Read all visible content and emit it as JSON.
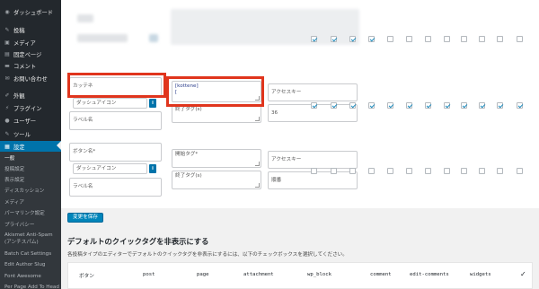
{
  "sidebar": {
    "items": [
      {
        "label": "ダッシュボード",
        "icon": "dashboard-icon",
        "glyph": "◉"
      },
      {
        "label": "投稿",
        "icon": "pushpin-icon",
        "glyph": "✎"
      },
      {
        "label": "メディア",
        "icon": "media-icon",
        "glyph": "▣"
      },
      {
        "label": "固定ページ",
        "icon": "page-icon",
        "glyph": "▤"
      },
      {
        "label": "コメント",
        "icon": "comment-icon",
        "glyph": "▬"
      },
      {
        "label": "お問い合わせ",
        "icon": "mail-icon",
        "glyph": "✉"
      },
      {
        "label": "外観",
        "icon": "brush-icon",
        "glyph": "✐"
      },
      {
        "label": "プラグイン",
        "icon": "plugin-icon",
        "glyph": "⚡"
      },
      {
        "label": "ユーザー",
        "icon": "user-icon",
        "glyph": "●"
      },
      {
        "label": "ツール",
        "icon": "wrench-icon",
        "glyph": "✎"
      },
      {
        "label": "設定",
        "icon": "settings-icon",
        "glyph": "▦"
      }
    ],
    "submenu": [
      "一般",
      "投稿設定",
      "表示設定",
      "ディスカッション",
      "メディア",
      "パーマリンク設定",
      "プライバシー",
      "Akismet Anti-Spam",
      "(アンチスパム)",
      "Batch Cat Settings",
      "Edit Author Slug",
      "Font Awesome",
      "Per Page Add To Head"
    ]
  },
  "rows": [
    {
      "label": "カッテネ",
      "icon_placeholder": "ダッシュアイコン",
      "label_placeholder": "ラベル名",
      "start_tag": "[kottene]\n[",
      "end_tag": "終了タグ(s)",
      "access_key": "アクセスキー",
      "order": "36"
    },
    {
      "label": "ボタン名*",
      "icon_placeholder": "ダッシュアイコン",
      "label_placeholder": "ラベル名",
      "start_tag": "開始タグ*",
      "end_tag": "終了タグ(s)",
      "access_key": "アクセスキー",
      "order": "順番"
    }
  ],
  "checkboxes": {
    "row0": [
      true,
      true,
      true,
      true,
      false,
      false,
      false,
      false,
      false,
      false,
      false,
      false,
      false,
      false,
      false
    ],
    "row1": [
      true,
      true,
      true,
      true,
      true,
      true,
      true,
      true,
      true,
      true,
      true,
      true,
      true,
      false,
      false
    ],
    "row2": [
      false,
      false,
      false,
      false,
      false,
      false,
      false,
      false,
      false,
      false,
      false,
      false,
      false,
      false,
      false
    ]
  },
  "save_button": "変更を保存",
  "section": {
    "title": "デフォルトのクイックタグを非表示にする",
    "description": "各投稿タイプのエディターでデフォルトのクイックタグを非表示にするには、以下のチェックボックスを選択してください。"
  },
  "table_headers": [
    "ボタン",
    "post",
    "page",
    "attachment",
    "wp_block",
    "comment",
    "edit-comments",
    "widgets",
    "✓"
  ],
  "colors": {
    "sidebar": "#23282d",
    "active": "#0073aa",
    "highlight": "#e0351d"
  }
}
